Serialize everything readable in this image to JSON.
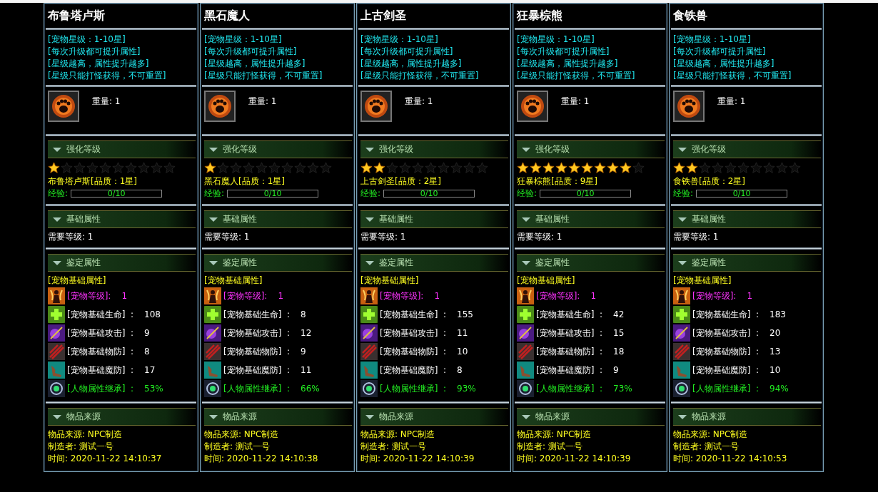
{
  "cards": [
    {
      "title": "布鲁塔卢斯",
      "info": [
        "[宠物星级：1-10星]",
        "[每次升级都可提升属性]",
        "[星级越高，属性提升越多]",
        "[星级只能打怪获得，不可重置]"
      ],
      "weight": "重量: 1",
      "sections": [
        "强化等级",
        "基础属性",
        "鉴定属性",
        "物品来源"
      ],
      "stars": 1,
      "quality": "布鲁塔卢斯[品质：1星]",
      "exp_label": "经验:",
      "exp_text": "0/10",
      "level": 0,
      "required_level": "需要等级: 1",
      "stats_header": "[宠物基础属性]",
      "stats": [
        {
          "kind": "level",
          "label": "[宠物等级]:",
          "value": "1"
        },
        {
          "kind": "hp",
          "label": "[宠物基础生命]  :",
          "value": "108"
        },
        {
          "kind": "attack",
          "label": "[宠物基础攻击]  :",
          "value": "9"
        },
        {
          "kind": "pdef",
          "label": "[宠物基础物防]  :",
          "value": "8"
        },
        {
          "kind": "mdef",
          "label": "[宠物基础魔防]  :",
          "value": "17"
        },
        {
          "kind": "inherit",
          "label": "[人物属性继承]  :",
          "value": "53%"
        }
      ],
      "source": [
        "物品来源: NPC制造",
        "制造者: 测试一号",
        "时间: 2020-11-22 14:10:37"
      ]
    },
    {
      "title": "黑石魔人",
      "info": [
        "[宠物星级：1-10星]",
        "[每次升级都可提升属性]",
        "[星级越高，属性提升越多]",
        "[星级只能打怪获得，不可重置]"
      ],
      "weight": "重量: 1",
      "sections": [
        "强化等级",
        "基础属性",
        "鉴定属性",
        "物品来源"
      ],
      "stars": 1,
      "quality": "黑石魔人[品质：1星]",
      "exp_label": "经验:",
      "exp_text": "0/10",
      "level": 0,
      "required_level": "需要等级: 1",
      "stats_header": "[宠物基础属性]",
      "stats": [
        {
          "kind": "level",
          "label": "[宠物等级]:",
          "value": "1"
        },
        {
          "kind": "hp",
          "label": "[宠物基础生命]  :",
          "value": "8"
        },
        {
          "kind": "attack",
          "label": "[宠物基础攻击]  :",
          "value": "12"
        },
        {
          "kind": "pdef",
          "label": "[宠物基础物防]  :",
          "value": "9"
        },
        {
          "kind": "mdef",
          "label": "[宠物基础魔防]  :",
          "value": "11"
        },
        {
          "kind": "inherit",
          "label": "[人物属性继承]  :",
          "value": "66%"
        }
      ],
      "source": [
        "物品来源: NPC制造",
        "制造者: 测试一号",
        "时间: 2020-11-22 14:10:38"
      ]
    },
    {
      "title": "上古剑圣",
      "info": [
        "[宠物星级：1-10星]",
        "[每次升级都可提升属性]",
        "[星级越高，属性提升越多]",
        "[星级只能打怪获得，不可重置]"
      ],
      "weight": "重量: 1",
      "sections": [
        "强化等级",
        "基础属性",
        "鉴定属性",
        "物品来源"
      ],
      "stars": 2,
      "quality": "上古剑圣[品质：2星]",
      "exp_label": "经验:",
      "exp_text": "0/10",
      "level": 0,
      "required_level": "需要等级: 1",
      "stats_header": "[宠物基础属性]",
      "stats": [
        {
          "kind": "level",
          "label": "[宠物等级]:",
          "value": "1"
        },
        {
          "kind": "hp",
          "label": "[宠物基础生命]  :",
          "value": "155"
        },
        {
          "kind": "attack",
          "label": "[宠物基础攻击]  :",
          "value": "11"
        },
        {
          "kind": "pdef",
          "label": "[宠物基础物防]  :",
          "value": "10"
        },
        {
          "kind": "mdef",
          "label": "[宠物基础魔防]  :",
          "value": "8"
        },
        {
          "kind": "inherit",
          "label": "[人物属性继承]  :",
          "value": "93%"
        }
      ],
      "source": [
        "物品来源: NPC制造",
        "制造者: 测试一号",
        "时间: 2020-11-22 14:10:39"
      ]
    },
    {
      "title": "狂暴棕熊",
      "info": [
        "[宠物星级：1-10星]",
        "[每次升级都可提升属性]",
        "[星级越高，属性提升越多]",
        "[星级只能打怪获得，不可重置]"
      ],
      "weight": "重量: 1",
      "sections": [
        "强化等级",
        "基础属性",
        "鉴定属性",
        "物品来源"
      ],
      "stars": 9,
      "quality": "狂暴棕熊[品质：9星]",
      "exp_label": "经验:",
      "exp_text": "0/10",
      "level": 0,
      "required_level": "需要等级: 1",
      "stats_header": "[宠物基础属性]",
      "stats": [
        {
          "kind": "level",
          "label": "[宠物等级]:",
          "value": "1"
        },
        {
          "kind": "hp",
          "label": "[宠物基础生命]  :",
          "value": "42"
        },
        {
          "kind": "attack",
          "label": "[宠物基础攻击]  :",
          "value": "15"
        },
        {
          "kind": "pdef",
          "label": "[宠物基础物防]  :",
          "value": "18"
        },
        {
          "kind": "mdef",
          "label": "[宠物基础魔防]  :",
          "value": "9"
        },
        {
          "kind": "inherit",
          "label": "[人物属性继承]  :",
          "value": "73%"
        }
      ],
      "source": [
        "物品来源: NPC制造",
        "制造者: 测试一号",
        "时间: 2020-11-22 14:10:39"
      ]
    },
    {
      "title": "食铁兽",
      "info": [
        "[宠物星级：1-10星]",
        "[每次升级都可提升属性]",
        "[星级越高，属性提升越多]",
        "[星级只能打怪获得，不可重置]"
      ],
      "weight": "重量: 1",
      "sections": [
        "强化等级",
        "基础属性",
        "鉴定属性",
        "物品来源"
      ],
      "stars": 2,
      "quality": "食铁兽[品质：2星]",
      "exp_label": "经验:",
      "exp_text": "0/10",
      "level": 0,
      "required_level": "需要等级: 1",
      "stats_header": "[宠物基础属性]",
      "stats": [
        {
          "kind": "level",
          "label": "[宠物等级]:",
          "value": "1"
        },
        {
          "kind": "hp",
          "label": "[宠物基础生命]  :",
          "value": "183"
        },
        {
          "kind": "attack",
          "label": "[宠物基础攻击]  :",
          "value": "20"
        },
        {
          "kind": "pdef",
          "label": "[宠物基础物防]  :",
          "value": "13"
        },
        {
          "kind": "mdef",
          "label": "[宠物基础魔防]  :",
          "value": "10"
        },
        {
          "kind": "inherit",
          "label": "[人物属性继承]  :",
          "value": "94%"
        }
      ],
      "source": [
        "物品来源: NPC制造",
        "制造者: 测试一号",
        "时间: 2020-11-22 14:10:53"
      ]
    }
  ]
}
